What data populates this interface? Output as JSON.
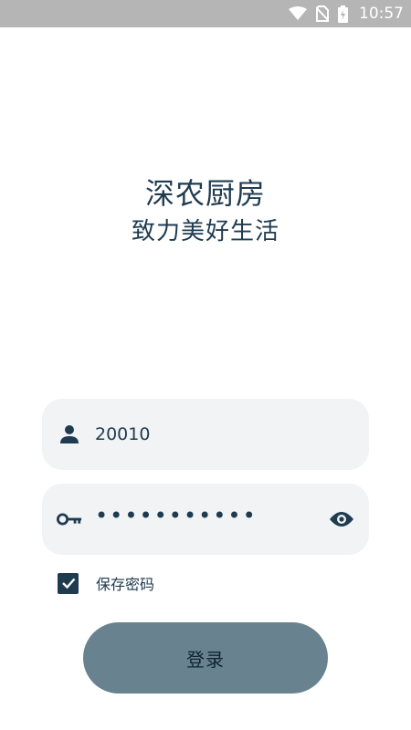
{
  "status_bar": {
    "time": "10:57",
    "icons": [
      "wifi-icon",
      "no-sim-icon",
      "battery-charging-icon"
    ]
  },
  "hero": {
    "title": "深农厨房",
    "subtitle": "致力美好生活"
  },
  "form": {
    "username": {
      "icon": "person-icon",
      "value": "20010"
    },
    "password": {
      "icon": "key-icon",
      "masked_value": "•••••••••••",
      "toggle_icon": "eye-icon"
    },
    "remember": {
      "checked": true,
      "label": "保存密码"
    },
    "login_label": "登录"
  },
  "colors": {
    "primary": "#1f3b50",
    "field_bg": "#f1f3f5",
    "button_bg": "#688290",
    "status_bar_bg": "#b5b5b5"
  }
}
